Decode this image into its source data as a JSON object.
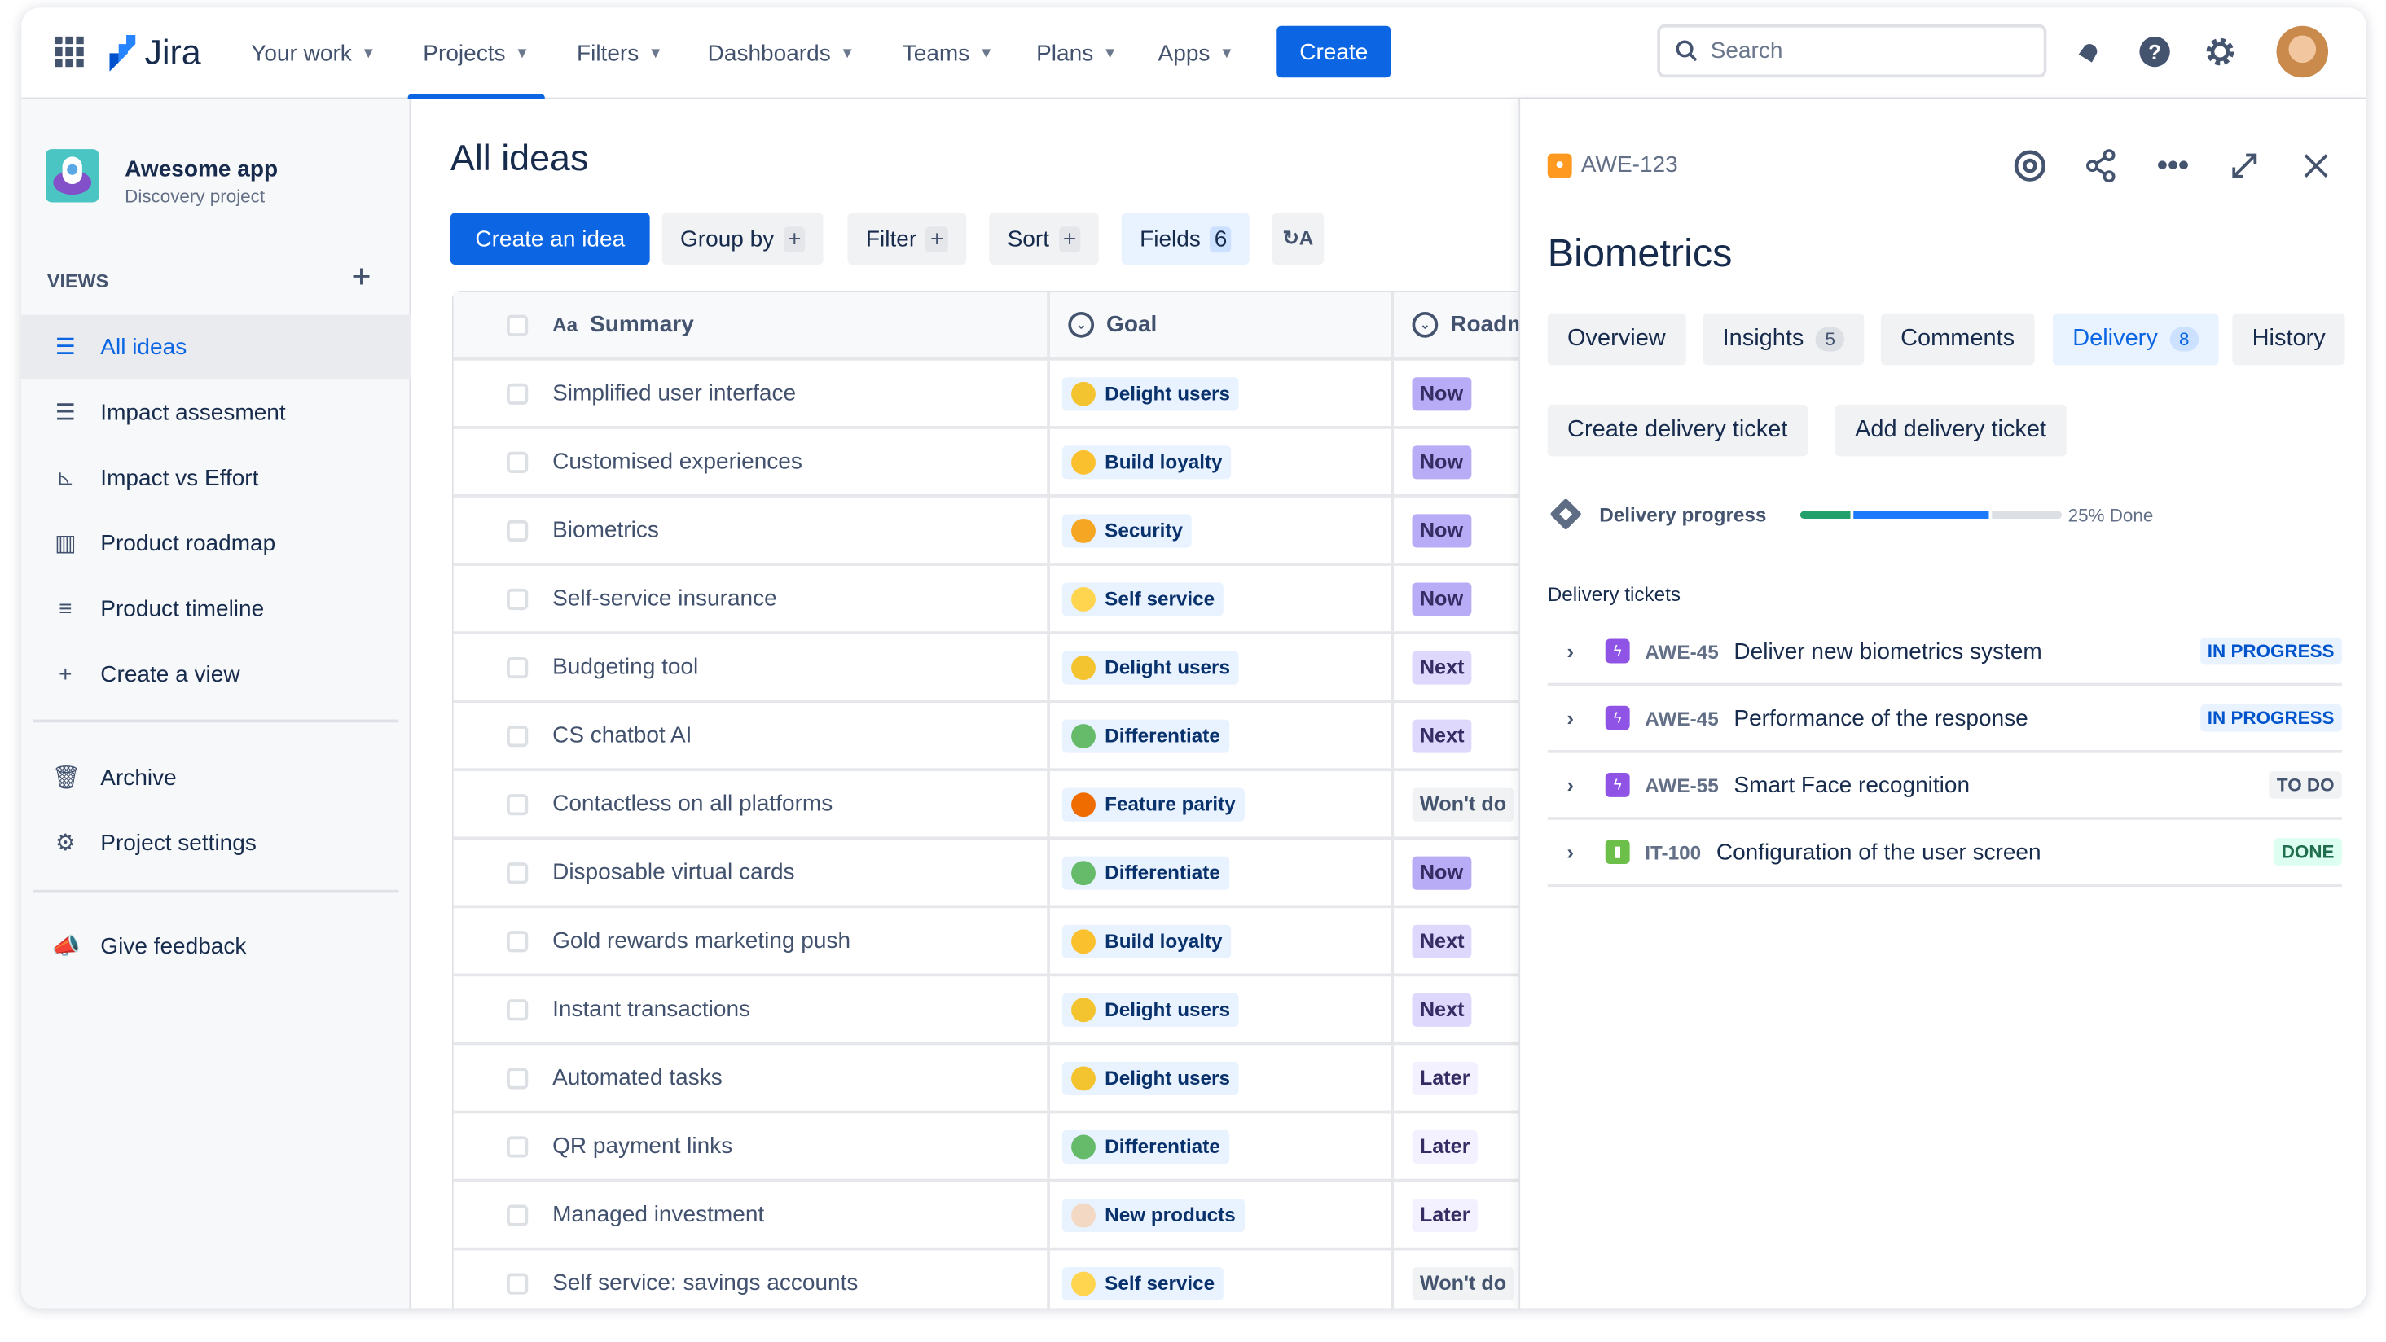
{
  "header": {
    "logo": "Jira",
    "nav": [
      {
        "label": "Your work"
      },
      {
        "label": "Projects",
        "active": true
      },
      {
        "label": "Filters"
      },
      {
        "label": "Dashboards"
      },
      {
        "label": "Teams"
      },
      {
        "label": "Plans"
      },
      {
        "label": "Apps"
      }
    ],
    "create_label": "Create",
    "search_placeholder": "Search",
    "icons": [
      "notifications-icon",
      "help-icon",
      "settings-icon",
      "avatar"
    ]
  },
  "sidebar": {
    "project_name": "Awesome app",
    "project_type": "Discovery project",
    "views_label": "VIEWS",
    "items": [
      {
        "label": "All ideas",
        "icon": "list-icon",
        "selected": true
      },
      {
        "label": "Impact assesment",
        "icon": "list-icon"
      },
      {
        "label": "Impact vs Effort",
        "icon": "chart-icon"
      },
      {
        "label": "Product roadmap",
        "icon": "board-icon"
      },
      {
        "label": "Product timeline",
        "icon": "timeline-icon"
      },
      {
        "label": "Create a view",
        "icon": "plus-icon"
      }
    ],
    "archive": "Archive",
    "project_settings": "Project settings",
    "feedback": "Give feedback"
  },
  "main": {
    "title": "All ideas",
    "toolbar": {
      "create": "Create an idea",
      "group_by": "Group by",
      "filter": "Filter",
      "sort": "Sort",
      "fields": "Fields",
      "fields_count": "6"
    },
    "columns": {
      "summary": "Summary",
      "summary_prefix": "Aa",
      "goal": "Goal",
      "roadmap": "Roadm"
    },
    "rows": [
      {
        "summary": "Simplified user interface",
        "goal": "Delight users",
        "roadmap": "Now"
      },
      {
        "summary": "Customised experiences",
        "goal": "Build loyalty",
        "roadmap": "Now"
      },
      {
        "summary": "Biometrics",
        "goal": "Security",
        "roadmap": "Now"
      },
      {
        "summary": "Self-service insurance",
        "goal": "Self service",
        "roadmap": "Now"
      },
      {
        "summary": "Budgeting tool",
        "goal": "Delight users",
        "roadmap": "Next"
      },
      {
        "summary": "CS chatbot AI",
        "goal": "Differentiate",
        "roadmap": "Next"
      },
      {
        "summary": "Contactless on all platforms",
        "goal": "Feature parity",
        "roadmap": "Won't do"
      },
      {
        "summary": "Disposable virtual cards",
        "goal": "Differentiate",
        "roadmap": "Now"
      },
      {
        "summary": "Gold rewards marketing push",
        "goal": "Build loyalty",
        "roadmap": "Next"
      },
      {
        "summary": "Instant transactions",
        "goal": "Delight users",
        "roadmap": "Next"
      },
      {
        "summary": "Automated tasks",
        "goal": "Delight users",
        "roadmap": "Later"
      },
      {
        "summary": "QR payment links",
        "goal": "Differentiate",
        "roadmap": "Later"
      },
      {
        "summary": "Managed investment",
        "goal": "New products",
        "roadmap": "Later"
      },
      {
        "summary": "Self service: savings accounts",
        "goal": "Self service",
        "roadmap": "Won't do"
      }
    ],
    "goal_colors": {
      "Delight users": "#f4c430",
      "Build loyalty": "#fbc02d",
      "Security": "#f5a623",
      "Self service": "#ffd54f",
      "Differentiate": "#66bb6a",
      "Feature parity": "#ef6c00",
      "New products": "#f3d9c4"
    }
  },
  "detail": {
    "key": "AWE-123",
    "title": "Biometrics",
    "tabs": [
      {
        "label": "Overview"
      },
      {
        "label": "Insights",
        "count": "5"
      },
      {
        "label": "Comments"
      },
      {
        "label": "Delivery",
        "count": "8",
        "selected": true
      },
      {
        "label": "History"
      }
    ],
    "create_ticket": "Create delivery ticket",
    "add_ticket": "Add delivery ticket",
    "progress_label": "Delivery progress",
    "progress": {
      "done": 0.19,
      "in_progress": 0.52,
      "text": "25% Done"
    },
    "tickets_label": "Delivery tickets",
    "tickets": [
      {
        "key": "AWE-45",
        "title": "Deliver new biometrics system",
        "status": "IN PROGRESS",
        "type": "epic"
      },
      {
        "key": "AWE-45",
        "title": "Performance of the response",
        "status": "IN PROGRESS",
        "type": "epic"
      },
      {
        "key": "AWE-55",
        "title": "Smart Face recognition",
        "status": "TO DO",
        "type": "epic"
      },
      {
        "key": "IT-100",
        "title": "Configuration of the user screen",
        "status": "DONE",
        "type": "story"
      }
    ]
  },
  "colors": {
    "accent": "#0c66e4",
    "done": "#22a06b",
    "in_progress": "#1d7afc",
    "epic": "#8f54e6",
    "story": "#6cc04a",
    "idea": "#ff991f"
  }
}
